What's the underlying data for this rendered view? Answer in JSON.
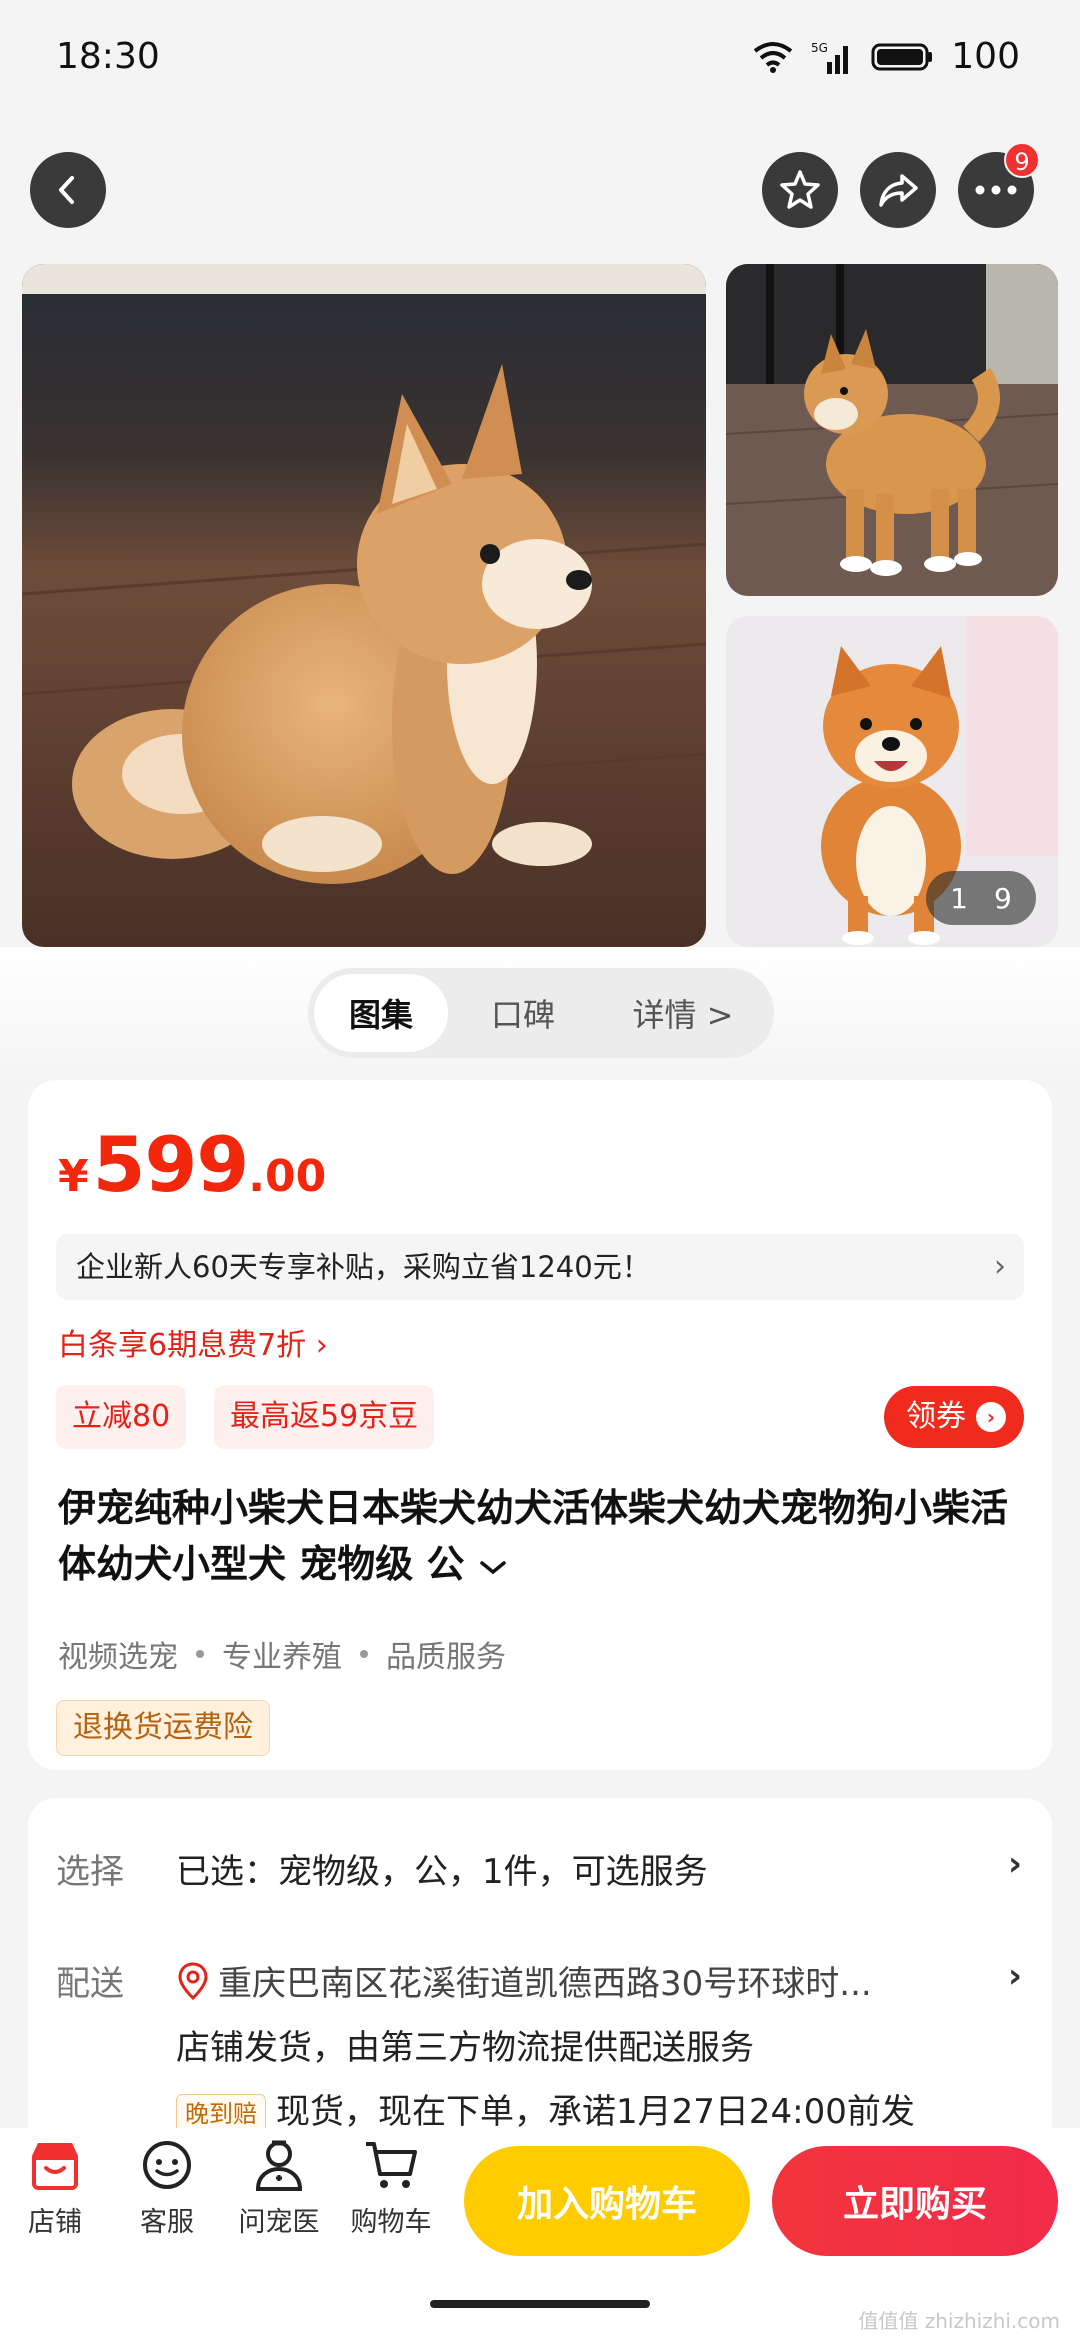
{
  "status_bar": {
    "time": "18:30",
    "network": "5G",
    "battery": "100"
  },
  "nav": {
    "more_badge": "9"
  },
  "gallery": {
    "current": "1",
    "total": "9"
  },
  "tabs": [
    {
      "label": "图集"
    },
    {
      "label": "口碑"
    },
    {
      "label": "详情 >"
    }
  ],
  "price": {
    "symbol": "¥",
    "integer": "599",
    "decimal": ".00"
  },
  "subsidy": {
    "text": "企业新人60天专享补贴，采购立省1240元！",
    "chevron": "›"
  },
  "baitiao": "白条享6期息费7折 ›",
  "promo_tags": [
    "立减80",
    "最高返59京豆"
  ],
  "coupon": {
    "label": "领券",
    "arrow": "›"
  },
  "product": {
    "title": "伊宠纯种小柴犬日本柴犬幼犬活体柴犬幼犬宠物狗小柴活体幼犬小型犬 宠物级 公",
    "features": [
      "视频选宠",
      "专业养殖",
      "品质服务"
    ],
    "insurance": "退换货运费险"
  },
  "selection": {
    "label": "选择",
    "value": "已选：宠物级，公，1件，可选服务"
  },
  "delivery": {
    "label": "配送",
    "address": "重庆巴南区花溪街道凯德西路30号环球时...",
    "shipping": "店铺发货，由第三方物流提供配送服务",
    "late_badge": "晚到赔",
    "promise": "现货，现在下单，承诺1月27日24:00前发"
  },
  "bottom_bar": {
    "items": [
      {
        "label": "店铺"
      },
      {
        "label": "客服"
      },
      {
        "label": "问宠医"
      },
      {
        "label": "购物车"
      }
    ],
    "add_to_cart": "加入购物车",
    "buy_now": "立即购买"
  },
  "watermark": "值值值 zhizhizhi.com",
  "colors": {
    "price_red": "#f2270c",
    "cart_yellow": "#ffcc00",
    "buy_red": "#f2353c"
  }
}
